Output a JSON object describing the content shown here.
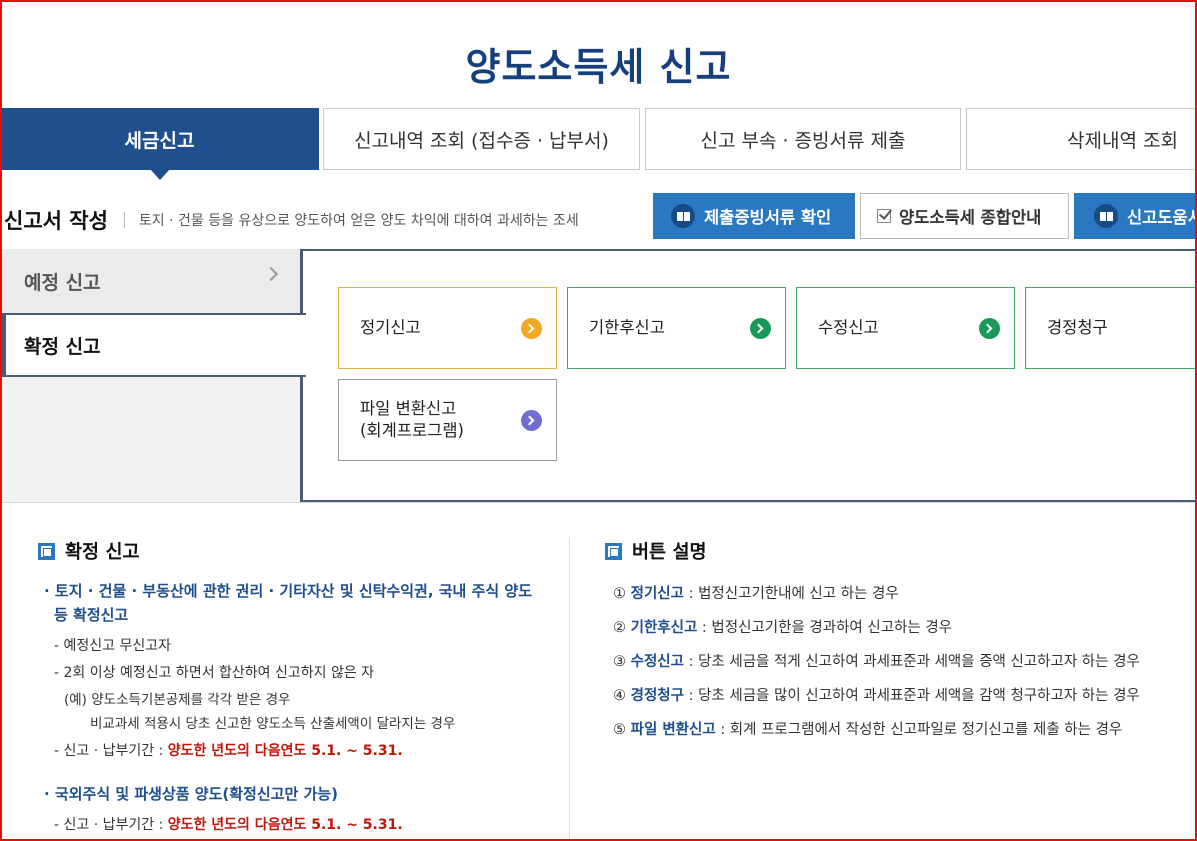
{
  "page_title": "양도소득세 신고",
  "tabs": [
    {
      "label": "세금신고",
      "active": true
    },
    {
      "label": "신고내역 조회 (접수증 · 납부서)",
      "active": false
    },
    {
      "label": "신고 부속 · 증빙서류 제출",
      "active": false
    },
    {
      "label": "삭제내역 조회",
      "active": false
    }
  ],
  "section": {
    "title": "신고서 작성",
    "description": "토지 · 건물 등을 유상으로 양도하여 얻은 양도 차익에 대하여 과세하는 조세"
  },
  "header_buttons": {
    "proof_docs": "제출증빙서류 확인",
    "guide": "양도소득세 종합안내",
    "help": "신고도움서비스"
  },
  "sidebar": {
    "items": [
      {
        "label": "예정 신고",
        "active": false
      },
      {
        "label": "확정 신고",
        "active": true
      }
    ]
  },
  "report_buttons": {
    "regular": "정기신고",
    "late": "기한후신고",
    "amend": "수정신고",
    "claim": "경정청구",
    "file_line1": "파일 변환신고",
    "file_line2": "(회계프로그램)"
  },
  "colors": {
    "primary_navy": "#1f4f8c",
    "button_blue": "#2a78c2",
    "accent_orange": "#f5a623",
    "accent_green": "#179a57",
    "accent_purple": "#6f6fd3",
    "deadline_red": "#c0150a"
  },
  "icons": {
    "proof_docs": "book-icon",
    "guide": "checkbox-icon",
    "help": "book-icon",
    "arrow": "chevron-right-icon"
  },
  "left_info": {
    "heading": "확정 신고",
    "group1": {
      "title_line1": "토지 · 건물 · 부동산에 관한 권리 · 기타자산 및 신탁수익권, 국내 주식 양도",
      "title_line2": "등 확정신고",
      "sub1": "예정신고 무신고자",
      "sub2": "2회 이상 예정신고 하면서 합산하여 신고하지 않은 자",
      "example1": "(예) 양도소득기본공제를 각각 받은 경우",
      "example2": "비교과세 적용시 당초 신고한 양도소득 산출세액이 달라지는 경우",
      "period_label": "신고 · 납부기간 :",
      "period_value": "양도한 년도의 다음연도 5.1. ~ 5.31."
    },
    "group2": {
      "title": "국외주식 및 파생상품 양도(확정신고만 가능)",
      "period_label": "신고 · 납부기간 :",
      "period_value": "양도한 년도의 다음연도 5.1. ~ 5.31."
    }
  },
  "right_info": {
    "heading": "버튼 설명",
    "items": [
      {
        "num": "①",
        "name": "정기신고",
        "desc": ": 법정신고기한내에 신고 하는 경우"
      },
      {
        "num": "②",
        "name": "기한후신고",
        "desc": ": 법정신고기한을 경과하여 신고하는 경우"
      },
      {
        "num": "③",
        "name": "수정신고",
        "desc": ": 당초 세금을 적게 신고하여 과세표준과 세액을 증액 신고하고자 하는 경우"
      },
      {
        "num": "④",
        "name": "경정청구",
        "desc": ": 당초 세금을 많이 신고하여 과세표준과 세액을 감액 청구하고자 하는 경우"
      },
      {
        "num": "⑤",
        "name": "파일 변환신고",
        "desc": ": 회계 프로그램에서 작성한 신고파일로 정기신고를  제출 하는 경우"
      }
    ]
  }
}
